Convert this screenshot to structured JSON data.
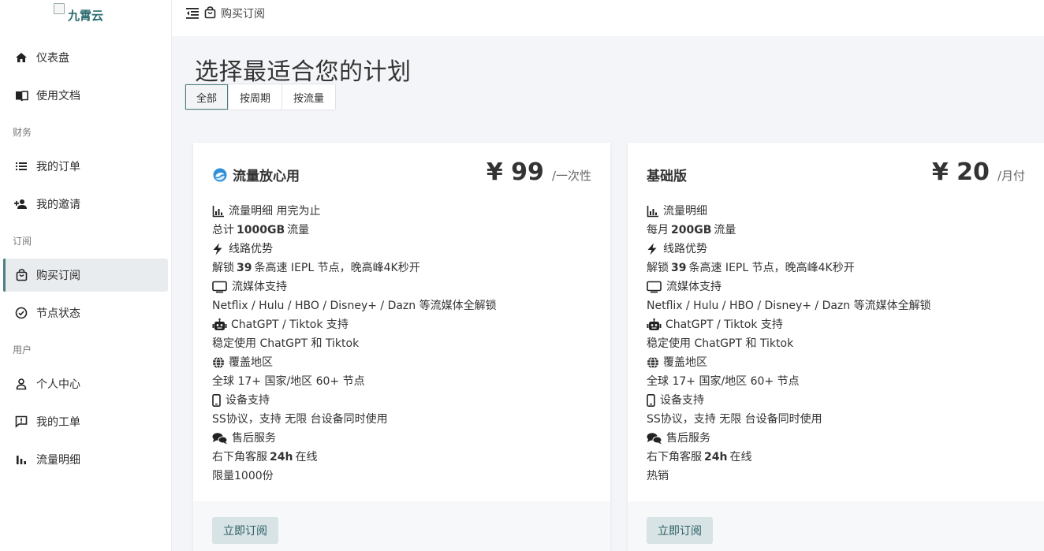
{
  "brand": {
    "name": "九霄云"
  },
  "sidebar": {
    "items": [
      {
        "label": "仪表盘",
        "icon": "home-icon"
      },
      {
        "label": "使用文档",
        "icon": "book-icon"
      },
      {
        "section": "财务"
      },
      {
        "label": "我的订单",
        "icon": "list-icon"
      },
      {
        "label": "我的邀请",
        "icon": "user-plus-icon"
      },
      {
        "section": "订阅"
      },
      {
        "label": "购买订阅",
        "icon": "shopping-bag-icon",
        "active": true
      },
      {
        "label": "节点状态",
        "icon": "check-circle-icon"
      },
      {
        "section": "用户"
      },
      {
        "label": "个人中心",
        "icon": "person-icon"
      },
      {
        "label": "我的工单",
        "icon": "ticket-icon"
      },
      {
        "label": "流量明细",
        "icon": "bar-chart-icon"
      }
    ],
    "labels": {
      "dashboard": "仪表盘",
      "docs": "使用文档",
      "finance": "财务",
      "orders": "我的订单",
      "invites": "我的邀请",
      "subscription": "订阅",
      "buy": "购买订阅",
      "nodes": "节点状态",
      "user": "用户",
      "profile": "个人中心",
      "tickets": "我的工单",
      "traffic": "流量明细"
    }
  },
  "topbar": {
    "breadcrumb": "购买订阅"
  },
  "main": {
    "title": "选择最适合您的计划",
    "filters": [
      "全部",
      "按周期",
      "按流量"
    ],
    "active_filter": "全部"
  },
  "plans": [
    {
      "name": "流量放心用",
      "price": "¥ 99",
      "period": "/一次性",
      "button": "立即订阅",
      "lines": {
        "h_traffic": "流量明细 用完为止",
        "traffic_pre": "总计",
        "traffic_val": "1000GB",
        "traffic_post": "流量",
        "h_route": "线路优势",
        "route_pre": "解锁",
        "route_val": "39",
        "route_post": "条高速 IEPL 节点，晚高峰4K秒开",
        "h_stream": "流媒体支持",
        "stream": "Netflix / Hulu / HBO / Disney+ / Dazn 等流媒体全解锁",
        "h_ai": "ChatGPT / Tiktok 支持",
        "ai": "稳定使用 ChatGPT 和 Tiktok",
        "h_region": "覆盖地区",
        "region": "全球 17+ 国家/地区 60+ 节点",
        "h_device": "设备支持",
        "device": "SS协议，支持 无限 台设备同时使用",
        "h_support": "售后服务",
        "support_pre": "右下角客服",
        "support_val": "24h",
        "support_post": "在线",
        "extra": "限量1000份"
      }
    },
    {
      "name": "基础版",
      "price": "¥ 20",
      "period": "/月付",
      "button": "立即订阅",
      "lines": {
        "h_traffic": "流量明细",
        "traffic_pre": "每月",
        "traffic_val": "200GB",
        "traffic_post": "流量",
        "h_route": "线路优势",
        "route_pre": "解锁",
        "route_val": "39",
        "route_post": "条高速 IEPL 节点，晚高峰4K秒开",
        "h_stream": "流媒体支持",
        "stream": "Netflix / Hulu / HBO / Disney+ / Dazn 等流媒体全解锁",
        "h_ai": "ChatGPT / Tiktok 支持",
        "ai": "稳定使用 ChatGPT 和 Tiktok",
        "h_region": "覆盖地区",
        "region": "全球 17+ 国家/地区 60+ 节点",
        "h_device": "设备支持",
        "device": "SS协议，支持 无限 台设备同时使用",
        "h_support": "售后服务",
        "support_pre": "右下角客服",
        "support_val": "24h",
        "support_post": "在线",
        "extra": "热销"
      }
    }
  ],
  "colors": {
    "accent": "#4b7f82",
    "button_bg": "#d8e3e5",
    "page_bg": "#f4f5f8"
  }
}
